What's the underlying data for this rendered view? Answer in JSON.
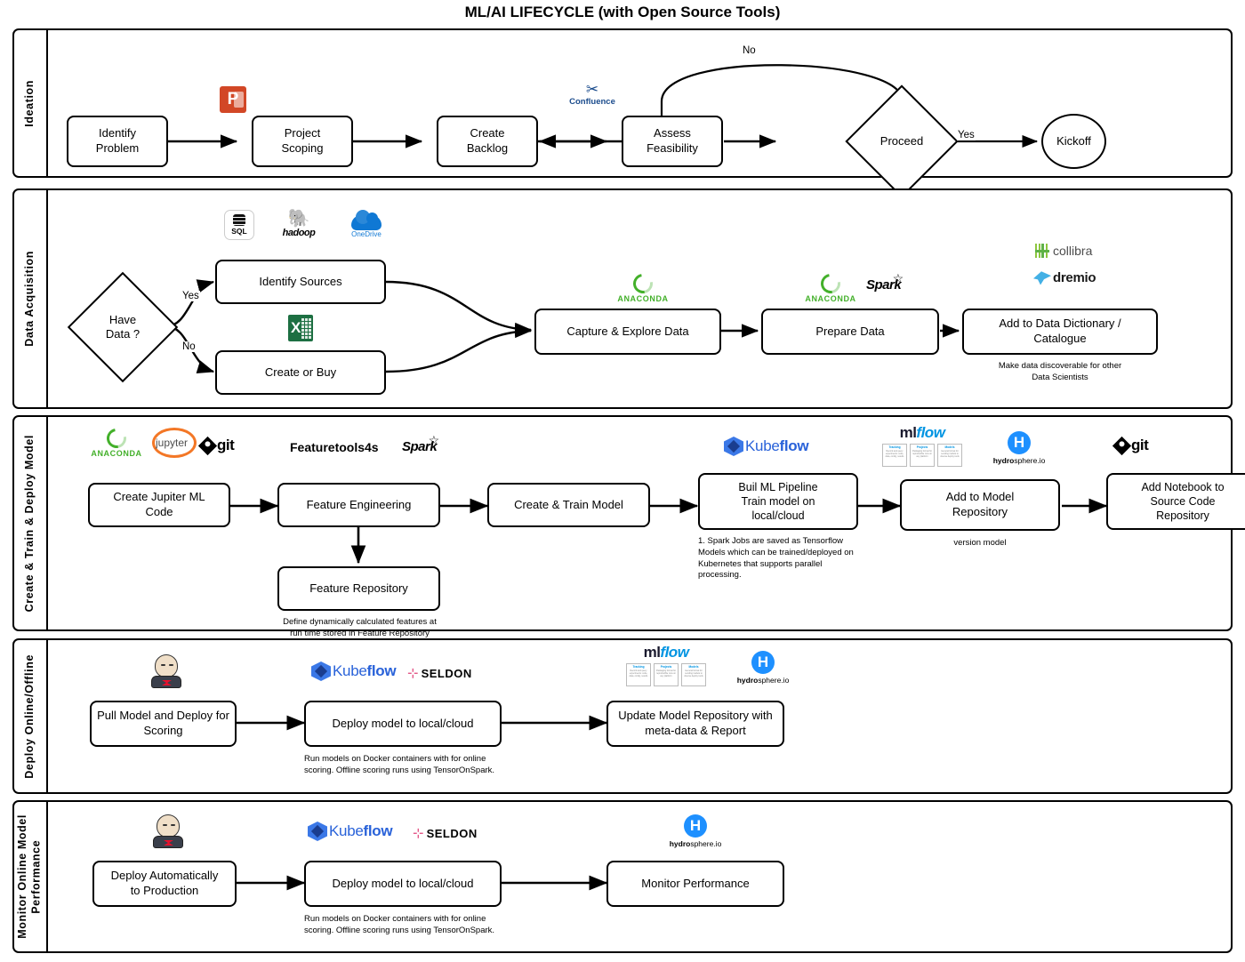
{
  "title": "ML/AI LIFECYCLE (with Open Source Tools)",
  "lanes": [
    {
      "id": "ideation",
      "label": "Ideation",
      "nodes": [
        {
          "id": "identify-problem",
          "label": "Identify\nProblem"
        },
        {
          "id": "project-scoping",
          "label": "Project\nScoping"
        },
        {
          "id": "create-backlog",
          "label": "Create\nBacklog"
        },
        {
          "id": "assess-feasibility",
          "label": "Assess\nFeasibility"
        },
        {
          "id": "proceed",
          "label": "Proceed"
        },
        {
          "id": "kickoff",
          "label": "Kickoff"
        }
      ],
      "edge_labels": {
        "no": "No",
        "yes": "Yes"
      },
      "tools": [
        {
          "name": "powerpoint-logo",
          "label": "P"
        },
        {
          "name": "confluence-logo",
          "label": "Confluence"
        }
      ]
    },
    {
      "id": "data-acquisition",
      "label": "Data Acquisition",
      "nodes": [
        {
          "id": "have-data",
          "label": "Have\nData ?"
        },
        {
          "id": "identify-sources",
          "label": "Identify Sources"
        },
        {
          "id": "create-or-buy",
          "label": "Create or Buy"
        },
        {
          "id": "capture-explore-data",
          "label": "Capture & Explore Data"
        },
        {
          "id": "prepare-data",
          "label": "Prepare Data"
        },
        {
          "id": "add-to-data-dictionary",
          "label": "Add to Data Dictionary /\nCatalogue"
        }
      ],
      "edge_labels": {
        "yes": "Yes",
        "no": "No"
      },
      "notes": [
        {
          "id": "catalogue-note",
          "text": "Make data discoverable for other\nData Scientists"
        }
      ],
      "tools": [
        {
          "name": "sql-logo",
          "label": "SQL"
        },
        {
          "name": "hadoop-logo",
          "label": "hadoop"
        },
        {
          "name": "onedrive-logo",
          "label": "OneDrive"
        },
        {
          "name": "excel-logo",
          "label": "X"
        },
        {
          "name": "anaconda-logo",
          "label": "ANACONDA"
        },
        {
          "name": "spark-logo",
          "label": "Spark"
        },
        {
          "name": "collibra-logo",
          "label": "collibra"
        },
        {
          "name": "dremio-logo",
          "label": "dremio"
        }
      ]
    },
    {
      "id": "create-train-deploy-model",
      "label": "Create & Train & Deploy  Model",
      "nodes": [
        {
          "id": "create-jupiter-ml-code",
          "label": "Create Jupiter ML\nCode"
        },
        {
          "id": "feature-engineering",
          "label": "Feature Engineering"
        },
        {
          "id": "feature-repository",
          "label": "Feature Repository"
        },
        {
          "id": "create-train-model",
          "label": "Create & Train Model"
        },
        {
          "id": "build-ml-pipeline",
          "label": "Buil ML Pipeline\nTrain model on\nlocal/cloud"
        },
        {
          "id": "add-to-model-repository",
          "label": "Add to Model\nRepository"
        },
        {
          "id": "add-notebook-to-source-code-repository",
          "label": "Add Notebook to\nSource Code\nRepository"
        }
      ],
      "notes": [
        {
          "id": "feature-repo-note",
          "text": "Define dynamically calculated features at\nrun time stored in Feature Repository"
        },
        {
          "id": "spark-jobs-note",
          "text": "1. Spark Jobs are saved as Tensorflow\nModels which can be trained/deployed on\nKubernetes that supports parallel\nprocessing."
        },
        {
          "id": "version-model-note",
          "text": "version model"
        }
      ],
      "tools": [
        {
          "name": "anaconda-logo",
          "label": "ANACONDA"
        },
        {
          "name": "jupyter-logo",
          "label": "jupyter"
        },
        {
          "name": "git-logo",
          "label": "git"
        },
        {
          "name": "featuretools4s-logo",
          "label": "Featuretools4s"
        },
        {
          "name": "spark-logo",
          "label": "Spark"
        },
        {
          "name": "kubeflow-logo",
          "label": "Kubeflow"
        },
        {
          "name": "mlflow-logo",
          "label": "mlflow"
        },
        {
          "name": "hydrosphere-logo",
          "label": "hydrosphere.io"
        }
      ]
    },
    {
      "id": "deploy-online-offline",
      "label": "Deploy Online/Offline",
      "nodes": [
        {
          "id": "pull-model-and-deploy",
          "label": "Pull Model and Deploy for\nScoring"
        },
        {
          "id": "deploy-model-local-cloud",
          "label": "Deploy model to local/cloud"
        },
        {
          "id": "update-model-repository",
          "label": "Update Model Repository with\nmeta-data & Report"
        }
      ],
      "notes": [
        {
          "id": "docker-note",
          "text": "Run models on Docker containers with for online\nscoring. Offline scoring runs using TensorOnSpark."
        }
      ],
      "tools": [
        {
          "name": "jenkins-logo",
          "label": "Jenkins"
        },
        {
          "name": "kubeflow-logo",
          "label": "Kubeflow"
        },
        {
          "name": "seldon-logo",
          "label": "SELDON"
        },
        {
          "name": "mlflow-logo",
          "label": "mlflow"
        },
        {
          "name": "hydrosphere-logo",
          "label": "hydrosphere.io"
        }
      ]
    },
    {
      "id": "monitor-online-model-performance",
      "label": "Monitor Online Model\nPerformance",
      "nodes": [
        {
          "id": "deploy-automatically-to-production",
          "label": "Deploy Automatically\nto Production"
        },
        {
          "id": "deploy-model-local-cloud-2",
          "label": "Deploy model to local/cloud"
        },
        {
          "id": "monitor-performance",
          "label": "Monitor Performance"
        }
      ],
      "notes": [
        {
          "id": "docker-note-2",
          "text": "Run models on Docker containers with for online\nscoring. Offline scoring runs using TensorOnSpark."
        }
      ],
      "tools": [
        {
          "name": "jenkins-logo",
          "label": "Jenkins"
        },
        {
          "name": "kubeflow-logo",
          "label": "Kubeflow"
        },
        {
          "name": "seldon-logo",
          "label": "SELDON"
        },
        {
          "name": "hydrosphere-logo",
          "label": "hydrosphere.io"
        }
      ]
    }
  ],
  "logo_text": {
    "anaconda": "ANACONDA",
    "spark": "Spark",
    "git": "git",
    "jupyter": "jupyter",
    "featuretools4s": "Featuretools4s",
    "kubeflow_light": "Kube",
    "kubeflow_bold": "flow",
    "seldon": "SELDON",
    "mlflow_ml": "ml",
    "mlflow_flow": "flow",
    "mlflow_boxes": [
      {
        "head": "Tracking",
        "body": "Record and query experiments: code, data, config, results"
      },
      {
        "head": "Projects",
        "body": "Packaging format for reproducible runs on any platform"
      },
      {
        "head": "Models",
        "body": "General format for sending models to diverse deploy tools"
      }
    ],
    "hydrosphere_bold": "hydro",
    "hydrosphere_rest": "sphere.io",
    "collibra": "collibra",
    "dremio": "dremio",
    "confluence": "Confluence",
    "powerpoint": "P",
    "excel": "X",
    "sql": "SQL",
    "hadoop": "hadoop",
    "onedrive": "OneDrive"
  },
  "colors": {
    "anaconda_green": "#43B02A",
    "kubeflow_blue": "#2962d9",
    "hydrosphere_blue": "#1E90FF",
    "mlflow_blue": "#0194E2",
    "confluence_blue": "#1a4b8c",
    "powerpoint_orange": "#D24726",
    "excel_green": "#1D6F42",
    "onedrive_blue": "#0F78D4",
    "collibra_green": "#5FB246",
    "dremio_cyan": "#43B0E5",
    "border": "#000000"
  }
}
